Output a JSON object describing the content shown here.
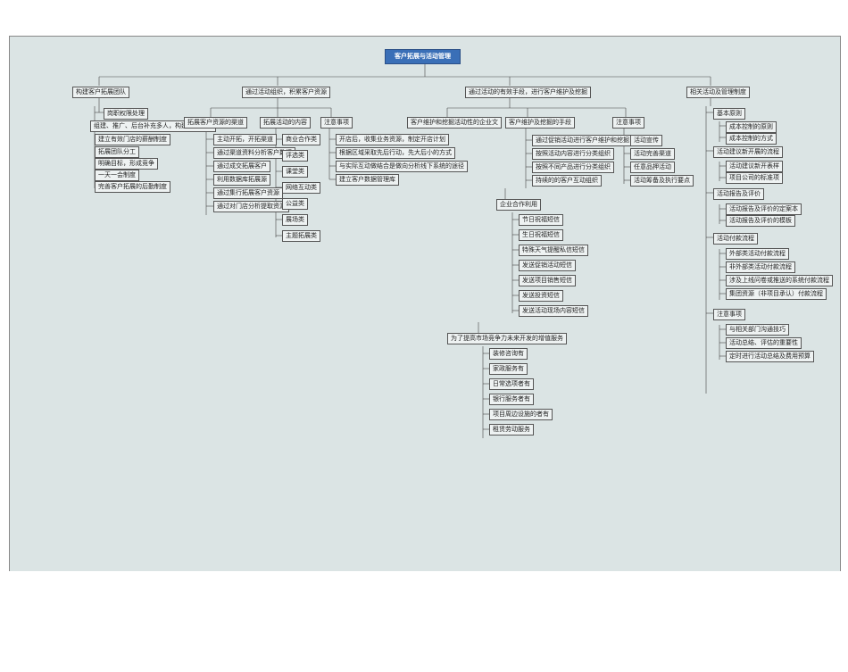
{
  "root": "客户拓展与活动管理",
  "b1": {
    "title": "构建客户拓展团队",
    "c1": "岗职权限处理",
    "c2": "组建、推广、后台补充多人，构建拓展团队",
    "c3": "建立有效门店的薪酬制度",
    "c4": "拓展团队分工",
    "c5": "明确目标，形成竞争",
    "c6": "一天一会制度",
    "c7": "完善客户拓展的后勤制度"
  },
  "b2": {
    "title": "通过活动组织，积累客户资源",
    "c1": {
      "title": "拓展客户资源的渠道",
      "i1": "主动开拓，开拓渠道",
      "i2": "通过渠道资料分析客户数据",
      "i3": "通过成交拓展客户",
      "i4": "利用数据库拓展源",
      "i5": "通过集行拓展客户资源",
      "i6": "通过对门店分析提取资源"
    },
    "c2": {
      "title": "拓展活动的内容",
      "i1": "商业合作类",
      "i2": "评选类",
      "i3": "课堂类",
      "i4": "网络互动类",
      "i5": "公益类",
      "i6": "展场类",
      "i7": "主题拓展类"
    },
    "c3": {
      "title": "注意事项",
      "i1": "开店后，收集业务资源，制定开店计划",
      "i2": "根据区域采取先后行动，先大后小的方式",
      "i3": "与实际互动做结合是做向分析线下系统的途径",
      "i4": "建立客户数据管理库"
    }
  },
  "b3": {
    "title": "通过活动的有效手段，进行客户维护及挖掘",
    "c1": "客户维护和挖掘活动性的企业文",
    "c2": {
      "title": "客户维护及挖掘的手段",
      "i1": "通过促销活动进行客户维护和挖掘",
      "i2": "按照活动内容进行分类组织",
      "i3": "按照不同产品进行分类组织",
      "i4": "持续的的客户互动组织"
    },
    "c3": {
      "title": "企业合作利用",
      "i1": "节日祝福短信",
      "i2": "生日祝福短信",
      "i3": "特殊天气提醒私信短信",
      "i4": "发送促销活动短信",
      "i5": "发送项目销售短信",
      "i6": "发送投资短信",
      "i7": "发送活动现场内容短信"
    },
    "c4": {
      "title": "为了提高市场竞争力未来开发的增值服务",
      "i1": "装修咨询有",
      "i2": "家政服务有",
      "i3": "日常选项者有",
      "i4": "银行服务者有",
      "i5": "项目周边设施的者有",
      "i6": "租赁劳动服务"
    },
    "c5": {
      "title": "注意事项",
      "i1": "活动宣传",
      "i2": "活动完善渠道",
      "i3": "任意品押活动",
      "i4": "活动筹备及执行要点"
    }
  },
  "b4": {
    "title": "相关活动及管理制度",
    "c1": {
      "title": "基本原则",
      "i1": "成本控制的原则",
      "i2": "成本控制的方式"
    },
    "c2": {
      "title": "活动建议新开展的流程",
      "i1": "活动建议新开表样",
      "i2": "项目公司的标准项"
    },
    "c3": {
      "title": "活动报告及评价",
      "i1": "活动报告及评价的定案本",
      "i2": "活动报告及评价的模板"
    },
    "c4": {
      "title": "活动付款流程",
      "i1": "外部类活动付款流程",
      "i2": "非外部类活动付款流程",
      "i3": "涉及上线问卷或推送的系统付款流程",
      "i4": "集团资源（非项目承认）付款流程"
    },
    "c5": {
      "title": "注意事项",
      "i1": "与相关部门沟通技巧",
      "i2": "活动总结、评估的重要性",
      "i3": "定时进行活动总结及费用预算"
    }
  }
}
